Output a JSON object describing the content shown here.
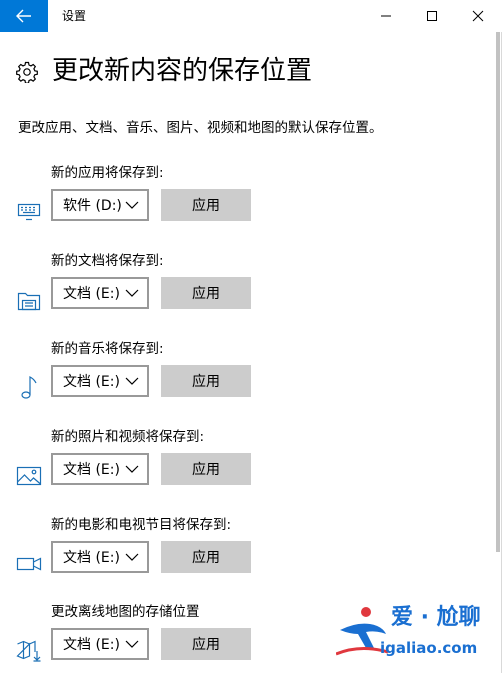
{
  "window": {
    "title": "设置",
    "back_icon": "arrow-left-icon",
    "minimize_icon": "minimize-icon",
    "maximize_icon": "maximize-icon",
    "close_icon": "close-icon",
    "accent_color": "#0078d7"
  },
  "page": {
    "title": "更改新内容的保存位置",
    "title_icon": "gear-icon",
    "description": "更改应用、文档、音乐、图片、视频和地图的默认保存位置。"
  },
  "sections": [
    {
      "label": "新的应用将保存到:",
      "icon": "monitor-icon",
      "drive": "软件 (D:)",
      "apply": "应用"
    },
    {
      "label": "新的文档将保存到:",
      "icon": "document-folder-icon",
      "drive": "文档 (E:)",
      "apply": "应用"
    },
    {
      "label": "新的音乐将保存到:",
      "icon": "music-note-icon",
      "drive": "文档 (E:)",
      "apply": "应用"
    },
    {
      "label": "新的照片和视频将保存到:",
      "icon": "picture-icon",
      "drive": "文档 (E:)",
      "apply": "应用"
    },
    {
      "label": "新的电影和电视节目将保存到:",
      "icon": "video-camera-icon",
      "drive": "文档 (E:)",
      "apply": "应用"
    },
    {
      "label": "更改离线地图的存储位置",
      "icon": "map-download-icon",
      "drive": "文档 (E:)",
      "apply": "应用"
    }
  ],
  "watermark": {
    "top": "爱 · 尬聊",
    "bottom": "igaliao.com"
  }
}
